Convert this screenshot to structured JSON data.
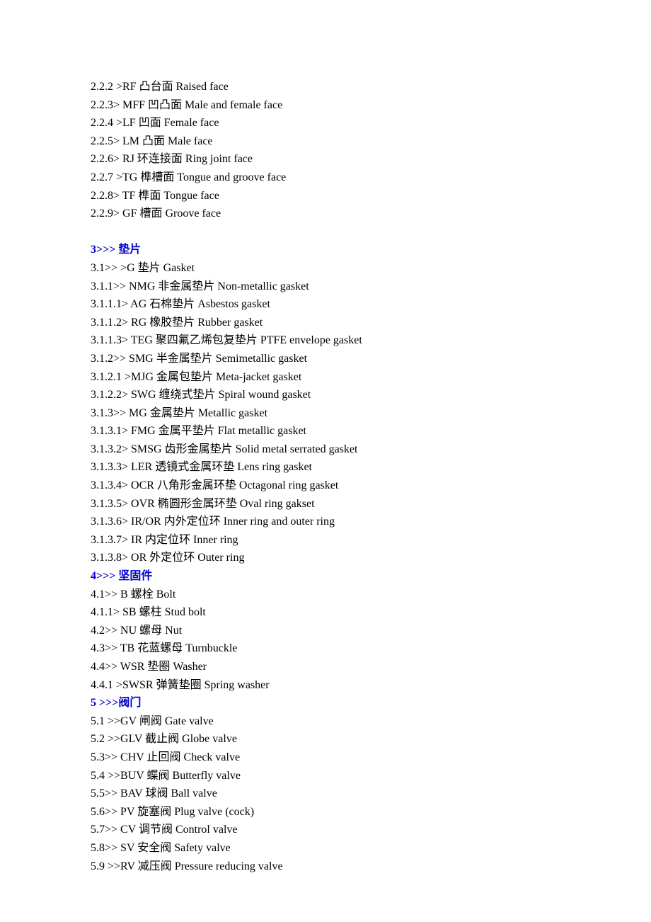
{
  "lines": [
    {
      "type": "line",
      "text": "2.2.2 >RF 凸台面 Raised face"
    },
    {
      "type": "line",
      "text": "2.2.3> MFF 凹凸面 Male and female face"
    },
    {
      "type": "line",
      "text": "2.2.4 >LF 凹面 Female face"
    },
    {
      "type": "line",
      "text": "2.2.5> LM 凸面 Male face"
    },
    {
      "type": "line",
      "text": "2.2.6> RJ 环连接面 Ring joint face"
    },
    {
      "type": "line",
      "text": "2.2.7 >TG 榫槽面 Tongue and groove face"
    },
    {
      "type": "line",
      "text": "2.2.8> TF 榫面 Tongue face"
    },
    {
      "type": "line",
      "text": "2.2.9> GF 槽面 Groove face"
    },
    {
      "type": "blank",
      "text": ""
    },
    {
      "type": "heading",
      "text": "3>>> 垫片"
    },
    {
      "type": "line",
      "text": "3.1>> >G 垫片 Gasket"
    },
    {
      "type": "line",
      "text": "3.1.1>> NMG 非金属垫片 Non-metallic gasket"
    },
    {
      "type": "line",
      "text": "3.1.1.1> AG 石棉垫片 Asbestos gasket"
    },
    {
      "type": "line",
      "text": "3.1.1.2> RG 橡胶垫片 Rubber gasket"
    },
    {
      "type": "line",
      "text": "3.1.1.3> TEG 聚四氟乙烯包复垫片 PTFE envelope gasket"
    },
    {
      "type": "line",
      "text": "3.1.2>> SMG 半金属垫片 Semimetallic gasket"
    },
    {
      "type": "line",
      "text": "3.1.2.1 >MJG 金属包垫片 Meta-jacket gasket"
    },
    {
      "type": "line",
      "text": "3.1.2.2> SWG 缠绕式垫片 Spiral wound gasket"
    },
    {
      "type": "line",
      "text": "3.1.3>> MG 金属垫片 Metallic gasket"
    },
    {
      "type": "line",
      "text": "3.1.3.1> FMG 金属平垫片 Flat metallic gasket"
    },
    {
      "type": "line",
      "text": "3.1.3.2> SMSG 齿形金属垫片 Solid metal serrated gasket"
    },
    {
      "type": "line",
      "text": "3.1.3.3> LER 透镜式金属环垫 Lens ring gasket"
    },
    {
      "type": "line",
      "text": "3.1.3.4> OCR 八角形金属环垫 Octagonal ring gasket"
    },
    {
      "type": "line",
      "text": "3.1.3.5> OVR 椭圆形金属环垫 Oval ring gakset"
    },
    {
      "type": "line",
      "text": "3.1.3.6> IR/OR 内外定位环 Inner ring and outer ring"
    },
    {
      "type": "line",
      "text": "3.1.3.7> IR 内定位环 Inner ring"
    },
    {
      "type": "line",
      "text": "3.1.3.8> OR 外定位环 Outer ring"
    },
    {
      "type": "heading",
      "text": "4>>> 坚固件"
    },
    {
      "type": "line",
      "text": "4.1>> B 螺栓 Bolt"
    },
    {
      "type": "line",
      "text": "4.1.1> SB 螺柱 Stud bolt"
    },
    {
      "type": "line",
      "text": "4.2>> NU 螺母 Nut"
    },
    {
      "type": "line",
      "text": "4.3>> TB 花蓝螺母 Turnbuckle"
    },
    {
      "type": "line",
      "text": "4.4>> WSR 垫圈 Washer"
    },
    {
      "type": "line",
      "text": "4.4.1 >SWSR 弹簧垫圈 Spring washer"
    },
    {
      "type": "heading",
      "text": "5 >>>阀门"
    },
    {
      "type": "line",
      "text": "5.1 >>GV 闸阀 Gate valve"
    },
    {
      "type": "line",
      "text": "5.2 >>GLV 截止阀 Globe valve"
    },
    {
      "type": "line",
      "text": "5.3>> CHV 止回阀 Check valve"
    },
    {
      "type": "line",
      "text": "5.4 >>BUV 蝶阀 Butterfly valve"
    },
    {
      "type": "line",
      "text": "5.5>> BAV 球阀 Ball valve"
    },
    {
      "type": "line",
      "text": "5.6>> PV 旋塞阀 Plug valve (cock)"
    },
    {
      "type": "line",
      "text": "5.7>> CV 调节阀 Control valve"
    },
    {
      "type": "line",
      "text": "5.8>> SV 安全阀 Safety valve"
    },
    {
      "type": "line",
      "text": "5.9 >>RV 减压阀 Pressure reducing valve"
    }
  ]
}
